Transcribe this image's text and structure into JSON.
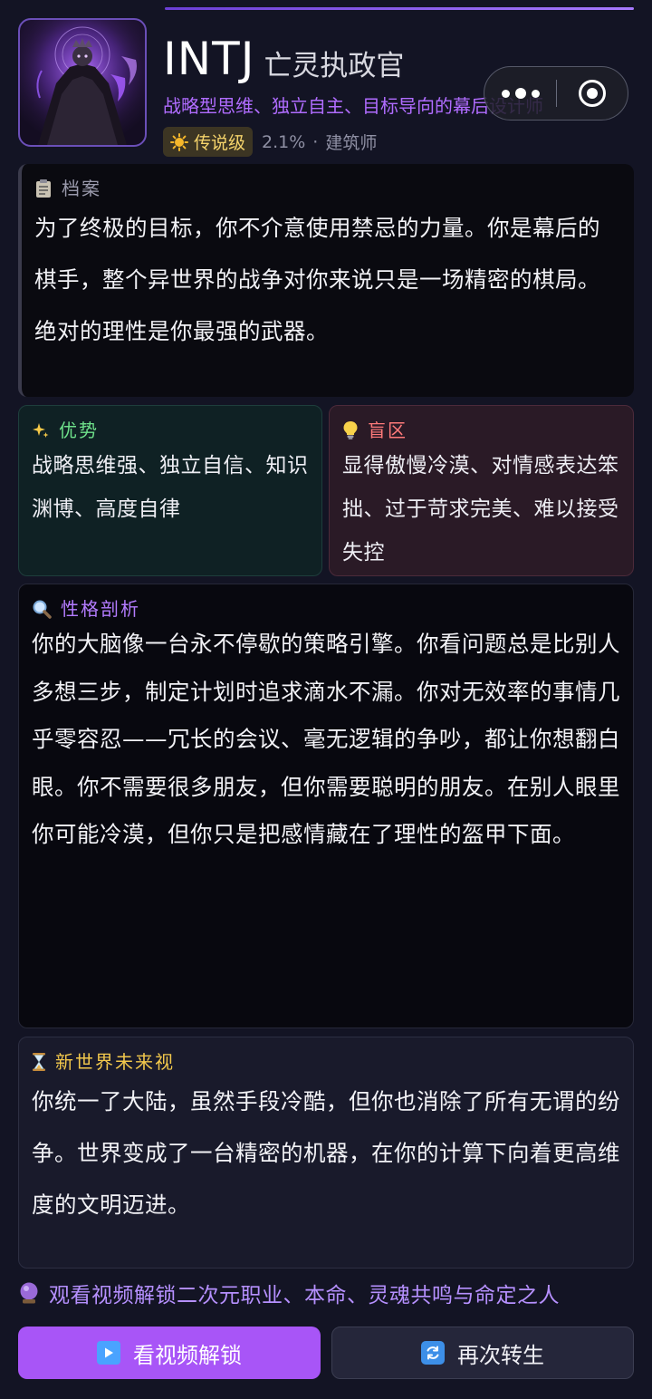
{
  "header": {
    "mbti": "INTJ",
    "class_name": "亡灵执政官",
    "subtitle": "战略型思维、独立自主、目标导向的幕后设计师",
    "tier": "传说级",
    "rarity": "2.1%",
    "separator": "·",
    "archetype": "建筑师"
  },
  "archive": {
    "title": "档案",
    "text": "为了终极的目标，你不介意使用禁忌的力量。你是幕后的棋手，整个异世界的战争对你来说只是一场精密的棋局。绝对的理性是你最强的武器。"
  },
  "strengths": {
    "title": "优势",
    "text": "战略思维强、独立自信、知识渊博、高度自律"
  },
  "blindspots": {
    "title": "盲区",
    "text": "显得傲慢冷漠、对情感表达笨拙、过于苛求完美、难以接受失控"
  },
  "analysis": {
    "title": "性格剖析",
    "text": "你的大脑像一台永不停歇的策略引擎。你看问题总是比别人多想三步，制定计划时追求滴水不漏。你对无效率的事情几乎零容忍——冗长的会议、毫无逻辑的争吵，都让你想翻白眼。你不需要很多朋友，但你需要聪明的朋友。在别人眼里你可能冷漠，但你只是把感情藏在了理性的盔甲下面。"
  },
  "future": {
    "title": "新世界未来视",
    "text": "你统一了大陆，虽然手段冷酷，但你也消除了所有无谓的纷争。世界变成了一台精密的机器，在你的计算下向着更高维度的文明迈进。"
  },
  "unlock_hint": "观看视频解锁二次元职业、本命、灵魂共鸣与命定之人",
  "buttons": {
    "watch": "看视频解锁",
    "reborn": "再次转生"
  },
  "icons": {
    "tier": "sun-icon",
    "archive": "clipboard-icon",
    "strengths": "sparkles-icon",
    "blindspots": "lightbulb-icon",
    "analysis": "magnifier-icon",
    "future": "hourglass-icon",
    "hint": "crystal-ball-icon",
    "watch": "play-icon",
    "reborn": "cycle-icon"
  },
  "colors": {
    "accent": "#a855f7",
    "subtitle": "#b06cff",
    "strength": "#6ee08a",
    "blindspot": "#ff7a7a",
    "future": "#f2c84c",
    "background": "#131424"
  }
}
